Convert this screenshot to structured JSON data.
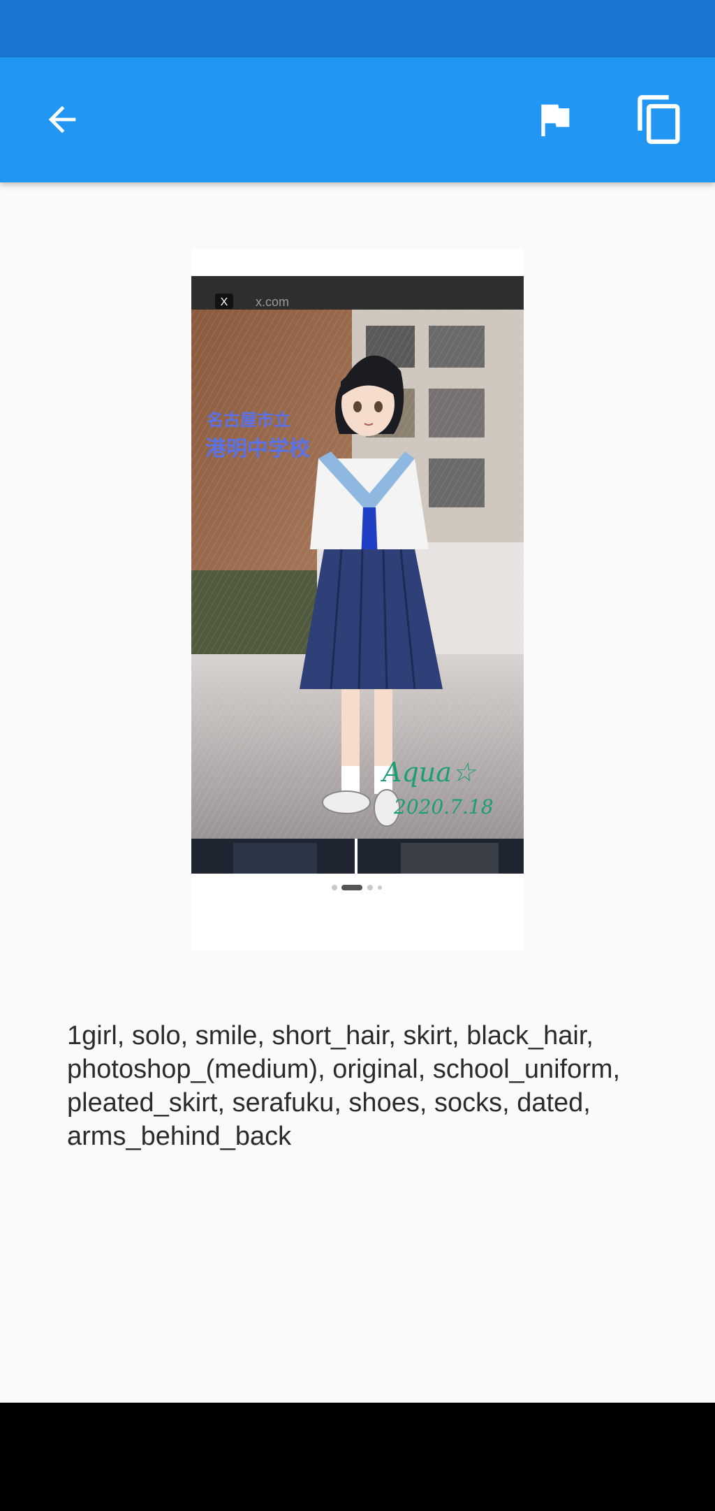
{
  "theme": {
    "status_bar_color": "#1976d2",
    "app_bar_color": "#2196f3",
    "background_color": "#fafafa",
    "nav_bar_color": "#000000"
  },
  "app_bar": {
    "back_icon": "arrow-back-icon",
    "flag_icon": "flag-icon",
    "copy_icon": "copy-icon"
  },
  "image": {
    "source_site": "x.com",
    "overlay_text_line1": "名古屋市立",
    "overlay_text_line2": "港明中学校",
    "signature": "Aqua☆",
    "date_text": "2020.7.18"
  },
  "tags_text": "1girl, solo, smile, short_hair, skirt, black_hair, photoshop_(medium), original, school_uniform, pleated_skirt, serafuku, shoes, socks, dated, arms_behind_back"
}
